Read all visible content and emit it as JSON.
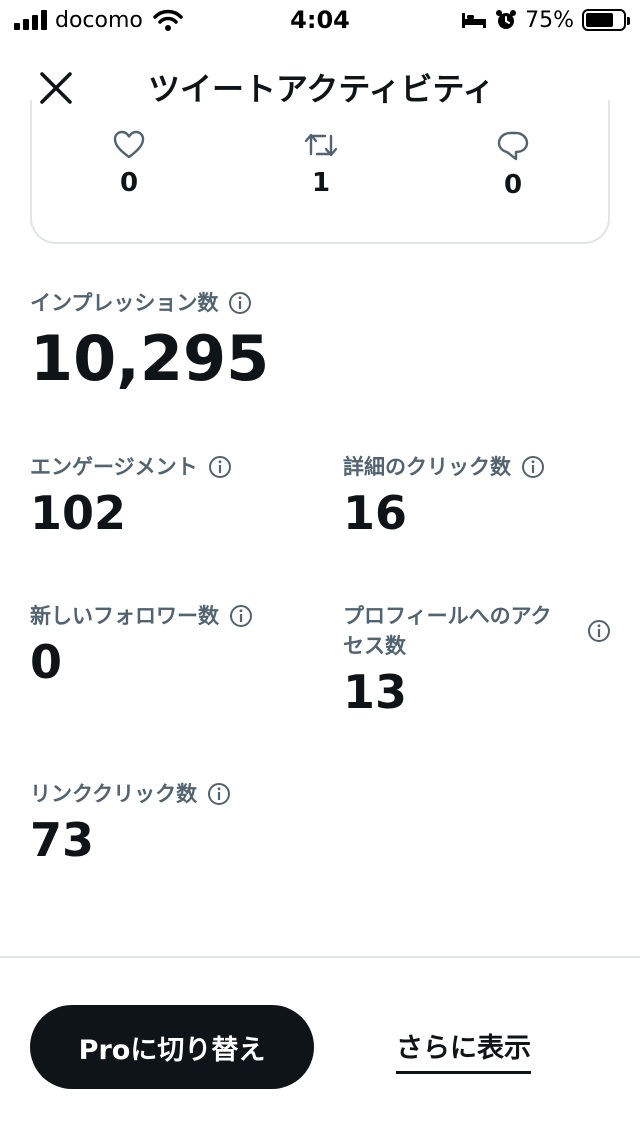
{
  "status_bar": {
    "carrier": "docomo",
    "time": "4:04",
    "battery": "75%",
    "battery_level": 0.75
  },
  "header": {
    "title": "ツイートアクティビティ",
    "close_icon": "close-icon"
  },
  "engagement_card": {
    "likes": {
      "icon": "heart-icon",
      "value": "0"
    },
    "retweets": {
      "icon": "retweet-icon",
      "value": "1"
    },
    "replies": {
      "icon": "reply-icon",
      "value": "0"
    }
  },
  "stats": {
    "impressions": {
      "label": "インプレッション数",
      "value": "10,295"
    },
    "engagements": {
      "label": "エンゲージメント",
      "value": "102"
    },
    "detail_clicks": {
      "label": "詳細のクリック数",
      "value": "16"
    },
    "new_followers": {
      "label": "新しいフォロワー数",
      "value": "0"
    },
    "profile_visits": {
      "label_line1": "プロフィールへのアク",
      "label_line2": "セス数",
      "value": "13"
    },
    "link_clicks": {
      "label": "リンククリック数",
      "value": "73"
    }
  },
  "footer": {
    "pro_button": "Proに切り替え",
    "more_link": "さらに表示"
  },
  "colors": {
    "text_primary": "#0f1419",
    "text_secondary": "#536471",
    "border": "#e1e5e8",
    "button_bg": "#0f1419"
  }
}
